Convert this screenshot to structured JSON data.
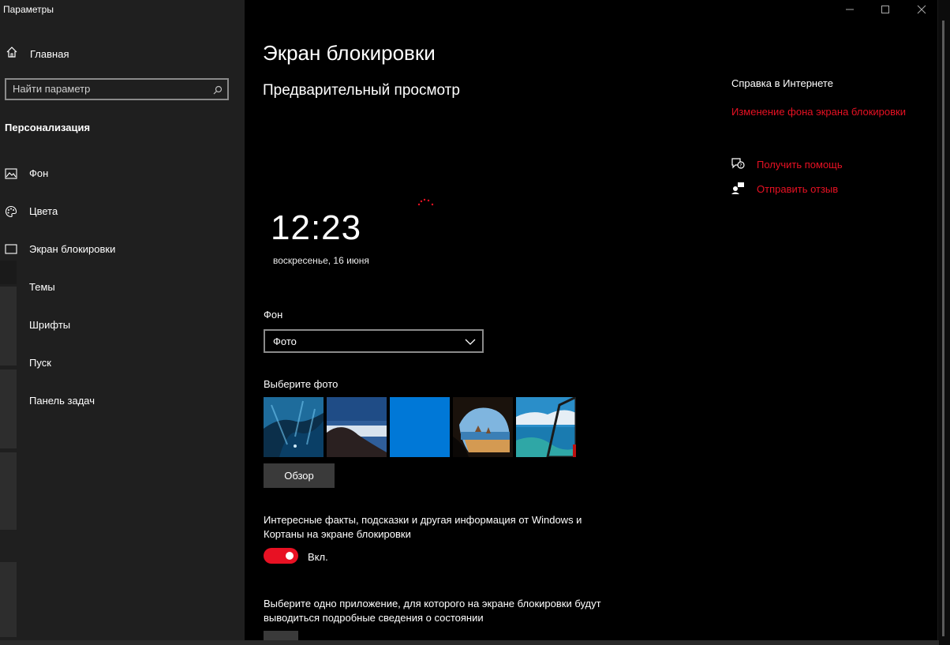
{
  "window": {
    "title": "Параметры",
    "controls": [
      "minimize-icon",
      "maximize-icon",
      "close-icon"
    ]
  },
  "sidebar": {
    "home_label": "Главная",
    "search_placeholder": "Найти параметр",
    "section_title": "Персонализация",
    "items": [
      {
        "label": "Фон",
        "icon": "image-icon"
      },
      {
        "label": "Цвета",
        "icon": "palette-icon"
      },
      {
        "label": "Экран блокировки",
        "icon": "lock-screen-icon"
      },
      {
        "label": "Темы",
        "icon": "themes-icon"
      },
      {
        "label": "Шрифты",
        "icon": "fonts-icon"
      },
      {
        "label": "Пуск",
        "icon": "start-icon"
      },
      {
        "label": "Панель задач",
        "icon": "taskbar-icon"
      }
    ]
  },
  "main": {
    "title": "Экран блокировки",
    "preview_heading": "Предварительный просмотр",
    "preview": {
      "time": "12:23",
      "date": "воскресенье, 16 июня"
    },
    "background_label": "Фон",
    "background_value": "Фото",
    "choose_photo_label": "Выберите фото",
    "browse_button": "Обзор",
    "fun_facts_text": "Интересные факты, подсказки и другая информация от Windows и Кортаны на экране блокировки",
    "toggle_state": "Вкл.",
    "app_status_text": "Выберите одно приложение, для которого на экране блокировки будут выводиться подробные сведения о состоянии"
  },
  "help": {
    "heading": "Справка в Интернете",
    "link_change_bg": "Изменение фона экрана блокировки",
    "get_help": "Получить помощь",
    "send_feedback": "Отправить отзыв"
  },
  "colors": {
    "accent": "#e81123",
    "sidebar_bg": "#1f1f1f",
    "main_bg": "#000000"
  }
}
